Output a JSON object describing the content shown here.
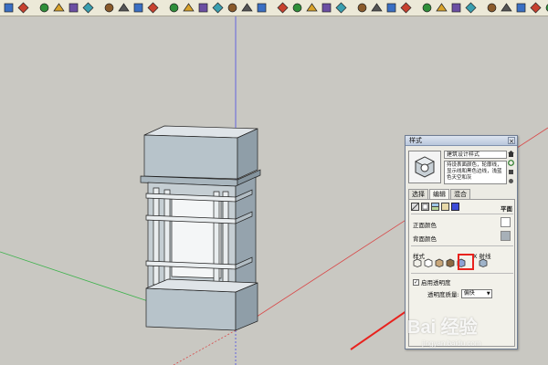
{
  "toolbar": {
    "icons": [
      "select-icon",
      "text-label-icon",
      "paint-bucket-icon",
      "orbit-icon",
      "pan-icon",
      "zoom-icon",
      "zoom-extents-icon",
      "component-icon",
      "materials-icon",
      "layers-icon",
      "camera-icon",
      "front-view-icon",
      "top-view-icon",
      "right-view-icon",
      "back-view-icon",
      "left-view-icon",
      "iso-view-icon",
      "xray-icon",
      "wireframe-icon",
      "hidden-line-icon",
      "shaded-icon",
      "textured-icon",
      "monochrome-icon",
      "section-icon",
      "walk-icon",
      "look-around-icon",
      "position-camera-icon",
      "measure-icon",
      "protractor-icon",
      "axes-icon",
      "dimension-icon",
      "sandbox-icon",
      "smoove-icon",
      "stamp-icon",
      "drape-icon",
      "flip-icon",
      "warehouse-icon"
    ]
  },
  "panel": {
    "title": "样式",
    "close": "×",
    "style_name": "建筑设计样式",
    "style_desc": "持设表面颜色，轮廓线，显示线和黑色边线，浅蓝色天空和灰",
    "tabs": [
      {
        "label": "选择"
      },
      {
        "label": "编辑"
      },
      {
        "label": "混合"
      }
    ],
    "edit_right_label": "平面",
    "front_color_label": "正面颜色",
    "back_color_label": "背面颜色",
    "style_label": "样式",
    "xray_label": "X 射线",
    "transparency_label": "启用透明度",
    "transparency_check": "✓",
    "quality_label": "透明度质量:",
    "quality_value": "偏快",
    "quality_arrow": "▼"
  },
  "colors": {
    "front_face": "#ffffff",
    "back_face": "#a7b0b8",
    "highlight": "#e8221d",
    "model_face": "#b7c3ca",
    "model_dark": "#8f9ea8",
    "axis_blue": "#4b4be6",
    "axis_red": "#d84a4a",
    "axis_green": "#3bb24a",
    "sky_ground": "#c9c8c2"
  },
  "watermark": {
    "main": "Bai 经验",
    "sub": "jingyan.baidu.com"
  }
}
